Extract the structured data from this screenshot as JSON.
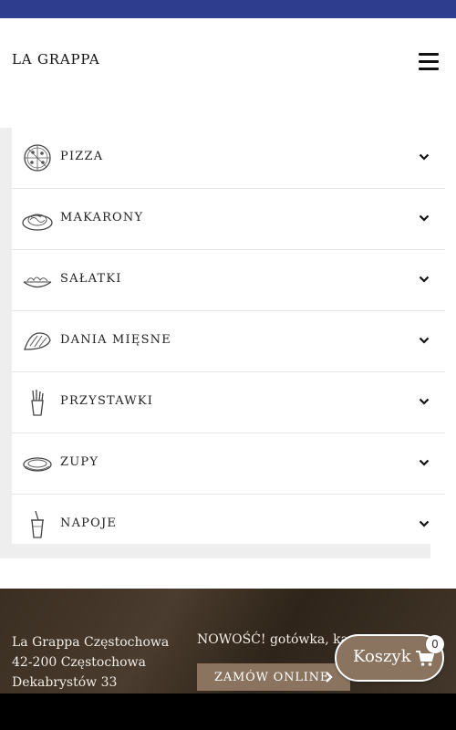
{
  "header": {
    "logo": "LA GRAPPA"
  },
  "menu": {
    "categories": [
      {
        "label": "PIZZA",
        "icon": "pizza-icon"
      },
      {
        "label": "MAKARONY",
        "icon": "pasta-icon"
      },
      {
        "label": "SAŁATKI",
        "icon": "salad-icon"
      },
      {
        "label": "DANIA MIĘSNE",
        "icon": "meat-icon"
      },
      {
        "label": "PRZYSTAWKI",
        "icon": "fries-icon"
      },
      {
        "label": "ZUPY",
        "icon": "soup-icon"
      },
      {
        "label": "NAPOJE",
        "icon": "drink-icon"
      }
    ]
  },
  "footer": {
    "address": [
      "La Grappa Częstochowa",
      "42-200 Częstochowa",
      "Dekabrystów 33"
    ],
    "news": "NOWOŚĆ! gotówka, kar",
    "order_label": "ZAMÓW ONLINE"
  },
  "cart": {
    "label": "Koszyk",
    "count": "0"
  },
  "colors": {
    "topbar": "#2f3d8f",
    "accent": "#8a7460"
  }
}
